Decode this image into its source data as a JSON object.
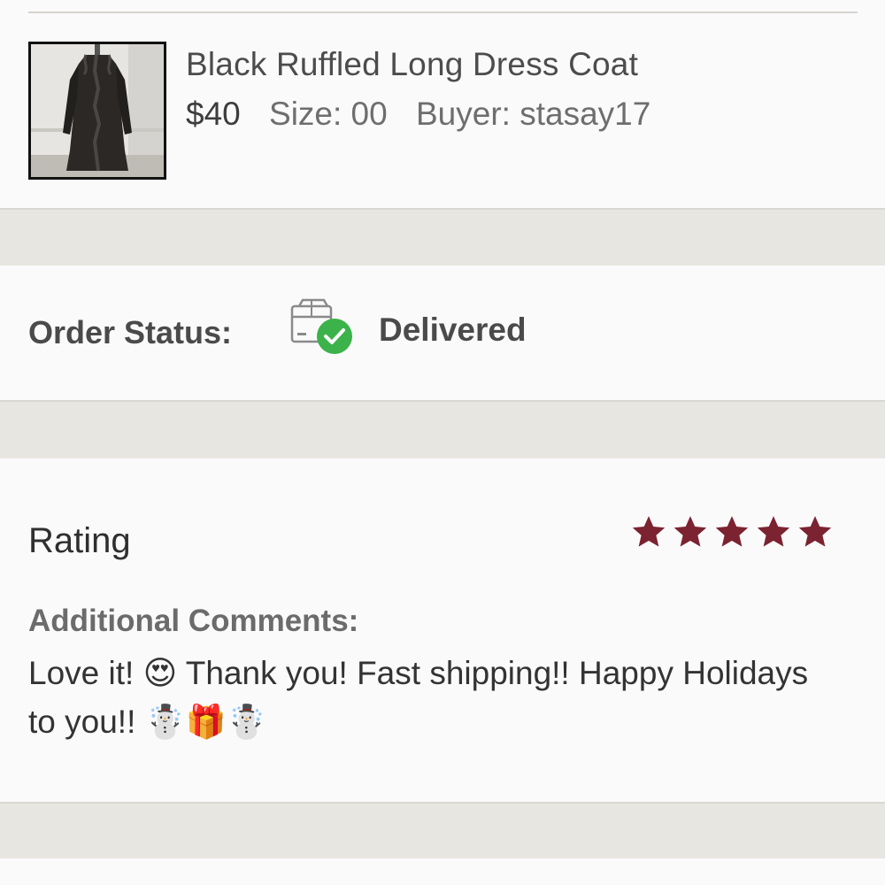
{
  "product": {
    "title": "Black Ruffled Long Dress Coat",
    "price": "$40",
    "size": "Size: 00",
    "buyer": "Buyer: stasay17"
  },
  "order": {
    "status_label": "Order Status:",
    "status_value": "Delivered",
    "status_icon": "package-delivered-icon",
    "status_color": "#3bb34a"
  },
  "review": {
    "rating_label": "Rating",
    "rating": 5,
    "max_rating": 5,
    "star_color": "#7b2330",
    "comments_label": "Additional Comments:",
    "comments_text": "Love it! 😍 Thank you! Fast shipping!! Happy Holidays to you!! ☃️🎁☃️"
  }
}
